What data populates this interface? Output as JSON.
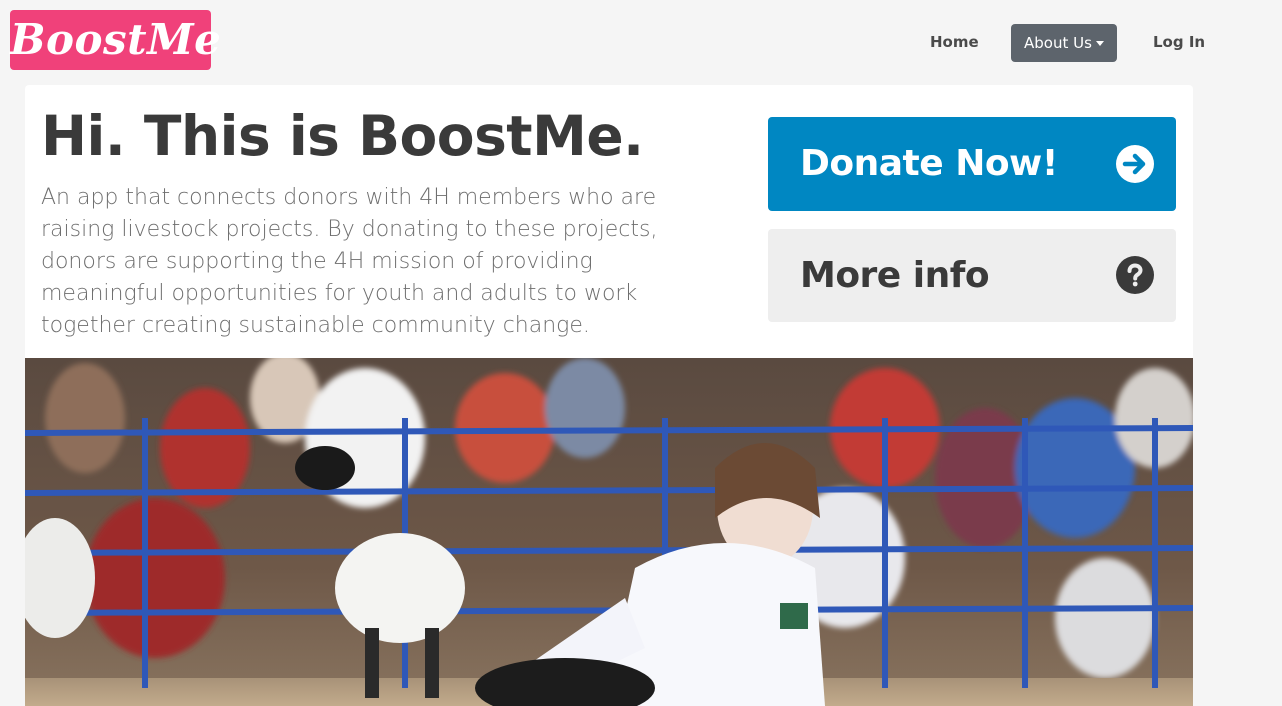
{
  "brand": {
    "name": "BoostMe",
    "color": "#f0417a"
  },
  "nav": {
    "items": [
      {
        "label": "Home"
      },
      {
        "label": "About Us",
        "has_dropdown": true
      },
      {
        "label": "Log In"
      }
    ]
  },
  "hero": {
    "title": "Hi. This is BoostMe.",
    "description": "An app that connects donors with 4H members who are raising livestock projects. By donating to these projects, donors are supporting the 4H mission of providing meaningful opportunities for youth and adults to work together creating sustainable community change."
  },
  "actions": {
    "donate": {
      "label": "Donate Now!",
      "icon": "arrow-right-circle-icon",
      "color": "#0087c2"
    },
    "more_info": {
      "label": "More info",
      "icon": "question-circle-icon",
      "color": "#eeeeee"
    }
  },
  "photo": {
    "subject": "livestock-show-photo"
  }
}
